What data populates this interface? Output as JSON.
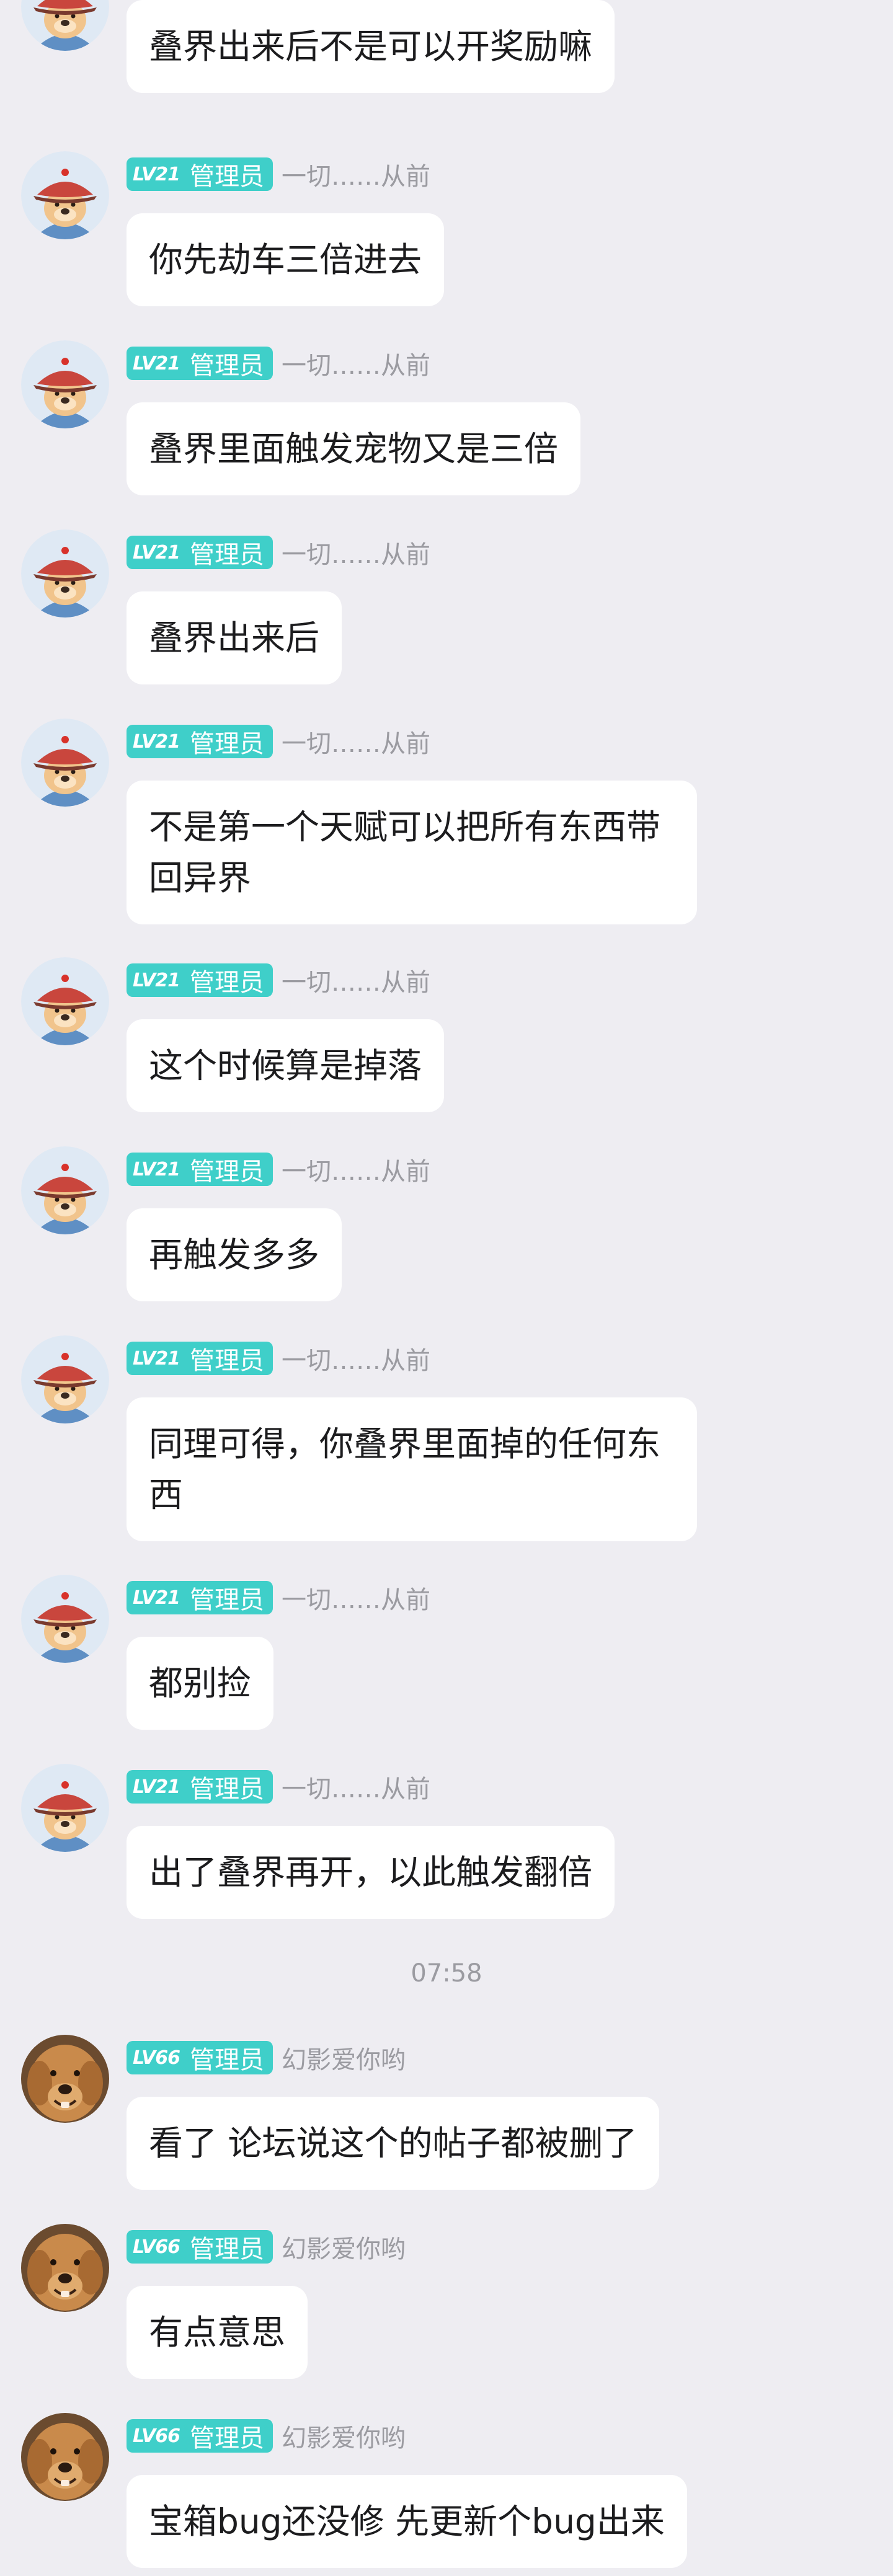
{
  "colors": {
    "background": "#eeedf2",
    "bubble": "#ffffff",
    "badge": "#3fcfc9",
    "meta_text": "#9b9ba1",
    "text": "#1c1c1e"
  },
  "badge_role": "管理员",
  "messages": [
    {
      "level": "LV21",
      "sender": "一切……从前",
      "avatar": "qing-hat-dog-avatar",
      "text": "叠界出来后不是可以开奖励嘛"
    },
    {
      "level": "LV21",
      "sender": "一切……从前",
      "avatar": "qing-hat-dog-avatar",
      "text": "你先劫车三倍进去"
    },
    {
      "level": "LV21",
      "sender": "一切……从前",
      "avatar": "qing-hat-dog-avatar",
      "text": "叠界里面触发宠物又是三倍"
    },
    {
      "level": "LV21",
      "sender": "一切……从前",
      "avatar": "qing-hat-dog-avatar",
      "text": "叠界出来后"
    },
    {
      "level": "LV21",
      "sender": "一切……从前",
      "avatar": "qing-hat-dog-avatar",
      "text": "不是第一个天赋可以把所有东西带回异界"
    },
    {
      "level": "LV21",
      "sender": "一切……从前",
      "avatar": "qing-hat-dog-avatar",
      "text": "这个时候算是掉落"
    },
    {
      "level": "LV21",
      "sender": "一切……从前",
      "avatar": "qing-hat-dog-avatar",
      "text": "再触发多多"
    },
    {
      "level": "LV21",
      "sender": "一切……从前",
      "avatar": "qing-hat-dog-avatar",
      "text": "同理可得，你叠界里面掉的任何东西"
    },
    {
      "level": "LV21",
      "sender": "一切……从前",
      "avatar": "qing-hat-dog-avatar",
      "text": "都别捡"
    },
    {
      "level": "LV21",
      "sender": "一切……从前",
      "avatar": "qing-hat-dog-avatar",
      "text": "出了叠界再开，以此触发翻倍"
    },
    {
      "level": "LV66",
      "sender": "幻影爱你哟",
      "avatar": "golden-retriever-avatar",
      "text": "看了 论坛说这个的帖子都被删了"
    },
    {
      "level": "LV66",
      "sender": "幻影爱你哟",
      "avatar": "golden-retriever-avatar",
      "text": "有点意思"
    },
    {
      "level": "LV66",
      "sender": "幻影爱你哟",
      "avatar": "golden-retriever-avatar",
      "text": "宝箱bug还没修 先更新个bug出来"
    }
  ],
  "timestamp": "07:58"
}
